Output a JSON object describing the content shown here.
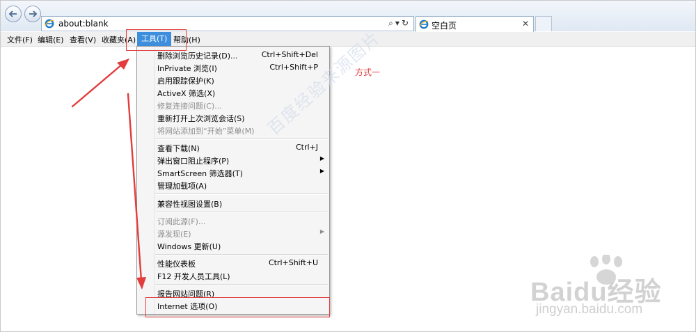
{
  "address_bar": {
    "url": "about:blank"
  },
  "tab": {
    "title": "空白页"
  },
  "menubar": {
    "items": [
      {
        "label": "文件(F)"
      },
      {
        "label": "编辑(E)"
      },
      {
        "label": "查看(V)"
      },
      {
        "label": "收藏夹(A)"
      },
      {
        "label": "工具(T)"
      },
      {
        "label": "帮助(H)"
      }
    ]
  },
  "tools_menu": {
    "items": [
      {
        "label": "删除浏览历史记录(D)...",
        "shortcut": "Ctrl+Shift+Del"
      },
      {
        "label": "InPrivate 浏览(I)",
        "shortcut": "Ctrl+Shift+P"
      },
      {
        "label": "启用跟踪保护(K)"
      },
      {
        "label": "ActiveX 筛选(X)"
      },
      {
        "label": "修复连接问题(C)...",
        "disabled": true
      },
      {
        "label": "重新打开上次浏览会话(S)"
      },
      {
        "label": "将网站添加到“开始”菜单(M)",
        "disabled": true
      },
      {
        "label": "查看下载(N)",
        "shortcut": "Ctrl+J"
      },
      {
        "label": "弹出窗口阻止程序(P)",
        "submenu": true
      },
      {
        "label": "SmartScreen 筛选器(T)",
        "submenu": true
      },
      {
        "label": "管理加载项(A)"
      },
      {
        "label": "兼容性视图设置(B)"
      },
      {
        "label": "订阅此源(F)...",
        "disabled": true
      },
      {
        "label": "源发现(E)",
        "disabled": true,
        "submenu": true
      },
      {
        "label": "Windows 更新(U)"
      },
      {
        "label": "性能仪表板",
        "shortcut": "Ctrl+Shift+U"
      },
      {
        "label": "F12 开发人员工具(L)"
      },
      {
        "label": "报告网站问题(R)"
      },
      {
        "label": "Internet 选项(O)"
      }
    ]
  },
  "annotation": {
    "text": "方式一",
    "color": "#e23c3c"
  },
  "watermark": {
    "site": "Baidu经验",
    "url": "jingyan.baidu.com",
    "diagonal": "百度经验来源图片"
  },
  "colors": {
    "menu_highlight": "#3e8ede",
    "annotation_red": "#e23c3c"
  },
  "icons": [
    "back-arrow-icon",
    "forward-arrow-icon",
    "ie-logo-icon",
    "search-icon",
    "dropdown-icon",
    "refresh-icon",
    "close-icon",
    "submenu-arrow-icon"
  ]
}
